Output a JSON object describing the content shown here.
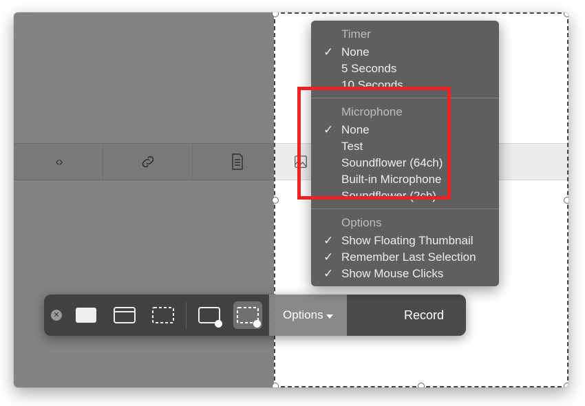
{
  "background_toolbar": {
    "nav_icon": "‹ ›"
  },
  "control_bar": {
    "options_label": "Options",
    "record_label": "Record"
  },
  "menu": {
    "sections": [
      {
        "title": "Timer",
        "items": [
          {
            "label": "None",
            "checked": true
          },
          {
            "label": "5 Seconds",
            "checked": false
          },
          {
            "label": "10 Seconds",
            "checked": false
          }
        ]
      },
      {
        "title": "Microphone",
        "items": [
          {
            "label": "None",
            "checked": true
          },
          {
            "label": "Test",
            "checked": false
          },
          {
            "label": "Soundflower (64ch)",
            "checked": false
          },
          {
            "label": "Built-in Microphone",
            "checked": false
          },
          {
            "label": "Soundflower (2ch)",
            "checked": false
          }
        ]
      },
      {
        "title": "Options",
        "items": [
          {
            "label": "Show Floating Thumbnail",
            "checked": true
          },
          {
            "label": "Remember Last Selection",
            "checked": true
          },
          {
            "label": "Show Mouse Clicks",
            "checked": true
          }
        ]
      }
    ]
  }
}
